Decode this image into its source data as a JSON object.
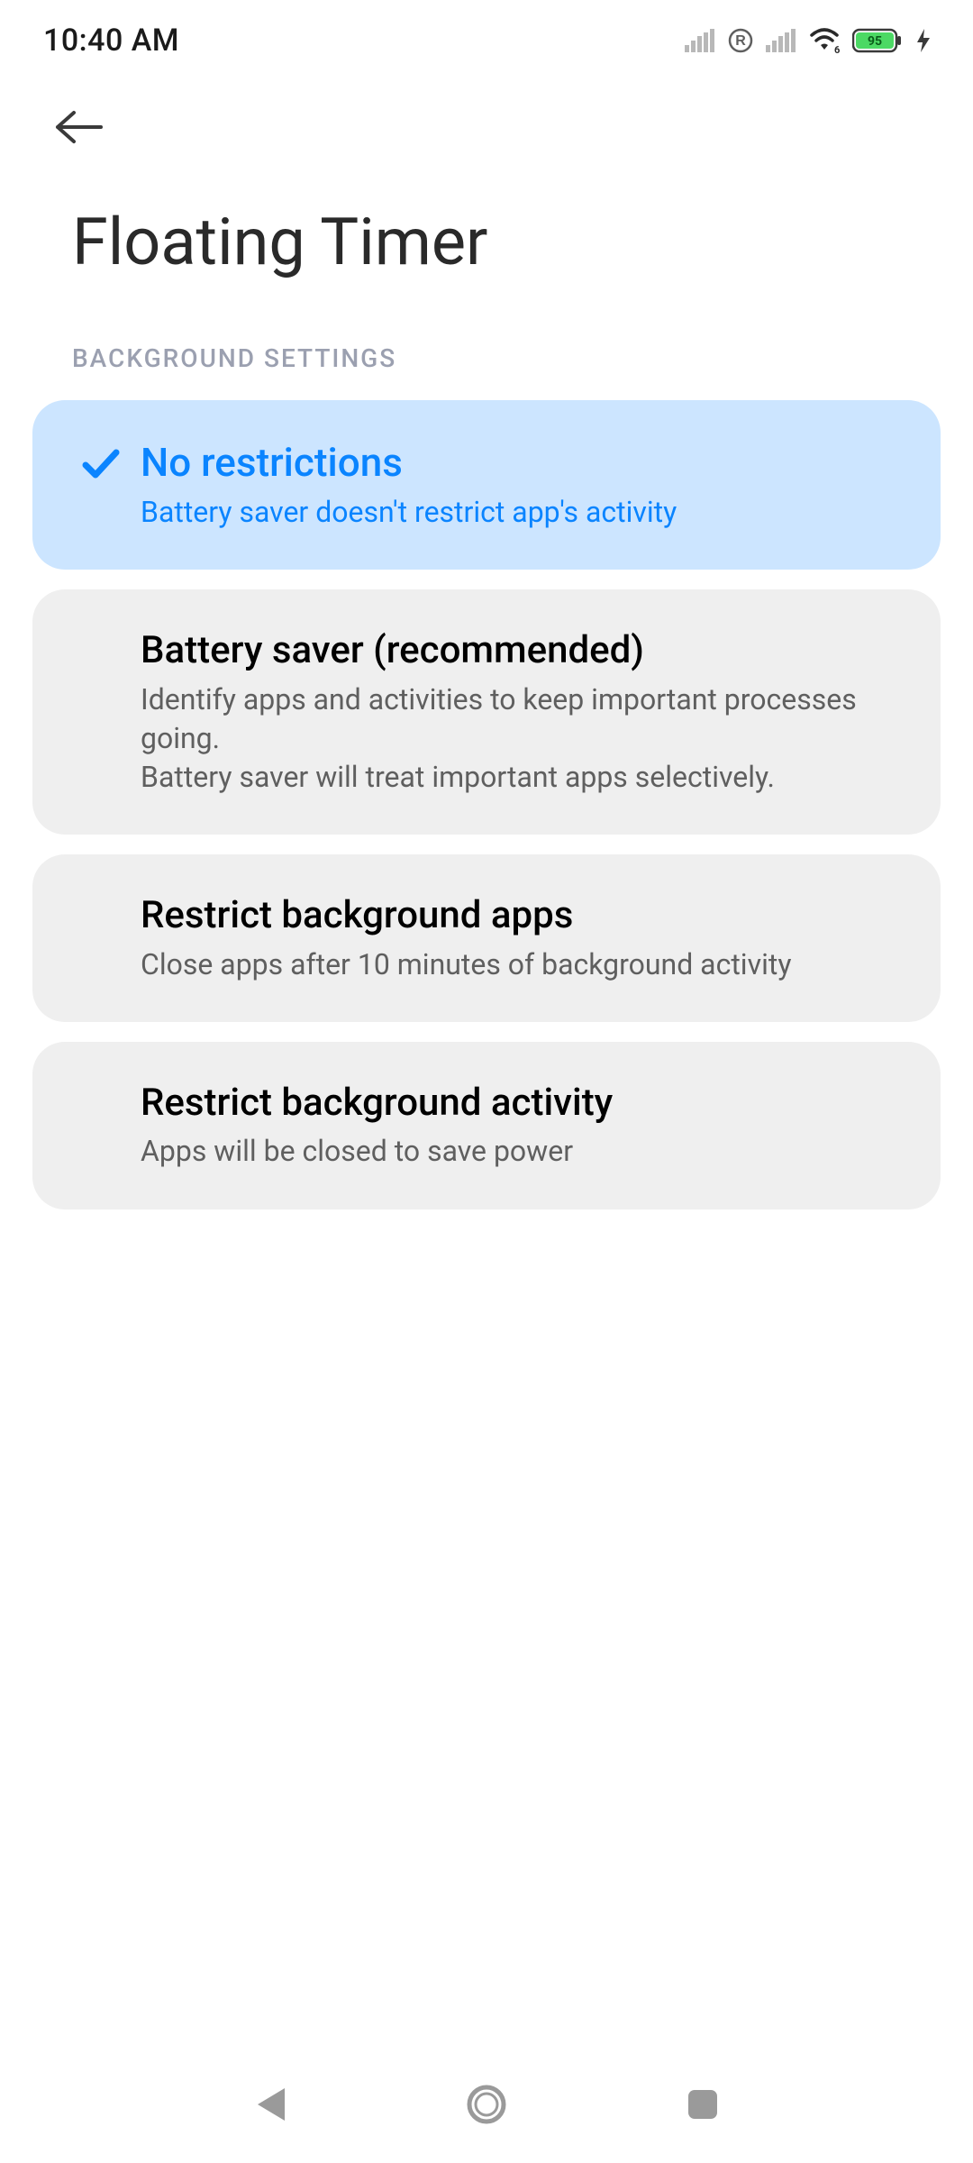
{
  "status": {
    "time": "10:40 AM",
    "battery_percent": "95"
  },
  "header": {
    "title": "Floating Timer"
  },
  "section_label": "BACKGROUND SETTINGS",
  "options": [
    {
      "title": "No restrictions",
      "subtitle": "Battery saver doesn't restrict app's activity",
      "selected": true
    },
    {
      "title": "Battery saver (recommended)",
      "subtitle": "Identify apps and activities to keep important processes going.\nBattery saver will treat important apps selectively.",
      "selected": false
    },
    {
      "title": "Restrict background apps",
      "subtitle": "Close apps after 10 minutes of background activity",
      "selected": false
    },
    {
      "title": "Restrict background activity",
      "subtitle": "Apps will be closed to save power",
      "selected": false
    }
  ]
}
